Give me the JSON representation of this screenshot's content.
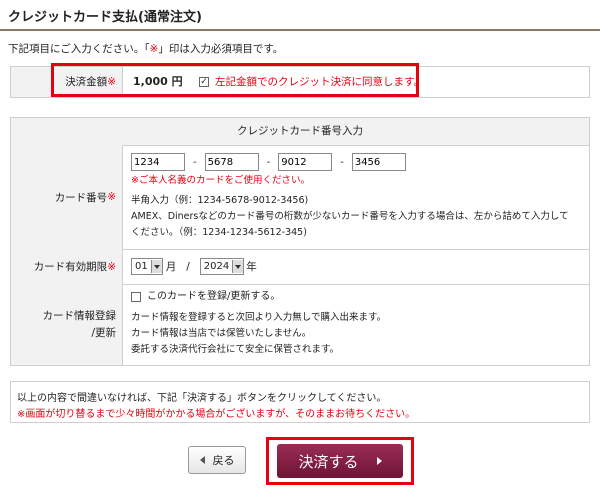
{
  "page_title": "クレジットカード支払(通常注文)",
  "intro": {
    "prefix": "下記項目にご入力ください。「",
    "mark": "※",
    "suffix": "」印は入力必須項目です。"
  },
  "amount": {
    "label": "決済金額",
    "required_mark": "※",
    "value": "1,000 円",
    "agree_checked": true,
    "agree_text": "左記金額でのクレジット決済に同意します。"
  },
  "card_section": {
    "header": "クレジットカード番号入力",
    "card_number": {
      "label": "カード番号",
      "required_mark": "※",
      "parts": [
        "1234",
        "5678",
        "9012",
        "3456"
      ],
      "separator": "-",
      "warning": "※ご本人名義のカードをご使用ください。",
      "hint1": "半角入力（例：1234-5678-9012-3456)",
      "hint2": "AMEX、Dinersなどのカード番号の桁数が少ないカード番号を入力する場合は、左から詰めて入力して",
      "hint3": "ください。（例：1234-1234-5612-345)"
    },
    "expiry": {
      "label": "カード有効期限",
      "required_mark": "※",
      "month": "01",
      "month_unit": "月",
      "slash": "/",
      "year": "2024",
      "year_unit": "年"
    },
    "register": {
      "label_line1": "カード情報登録",
      "label_line2": "/更新",
      "checkbox_checked": false,
      "checkbox_label": "このカードを登録/更新する。",
      "note1": "カード情報を登録すると次回より入力無しで購入出来ます。",
      "note2": "カード情報は当店では保管いたしません。",
      "note3": "委託する決済代行会社にて安全に保管されます。"
    }
  },
  "confirm": {
    "line1": "以上の内容で間違いなければ、下記「決済する」ボタンをクリックしてください。",
    "line2": "※画面が切り替るまで少々時間がかかる場合がございますが、そのままお待ちください。"
  },
  "buttons": {
    "back": "戻る",
    "pay": "決済する"
  },
  "colors": {
    "required_red": "#e60012",
    "pay_button": "#7d1c41",
    "highlight": "#e60012"
  }
}
